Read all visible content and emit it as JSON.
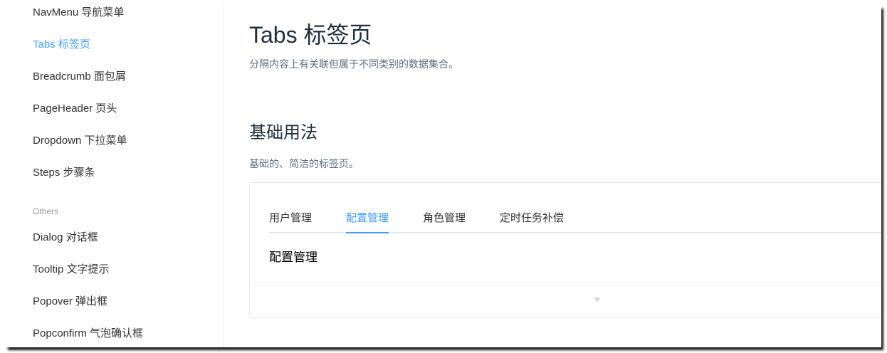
{
  "sidebar": {
    "items": [
      {
        "label": "NavMenu 导航菜单"
      },
      {
        "label": "Tabs 标签页",
        "active": true
      },
      {
        "label": "Breadcrumb 面包屑"
      },
      {
        "label": "PageHeader 页头"
      },
      {
        "label": "Dropdown 下拉菜单"
      },
      {
        "label": "Steps 步骤条"
      }
    ],
    "group_title": "Others",
    "group_items": [
      {
        "label": "Dialog 对话框"
      },
      {
        "label": "Tooltip 文字提示"
      },
      {
        "label": "Popover 弹出框"
      },
      {
        "label": "Popconfirm 气泡确认框"
      }
    ]
  },
  "main": {
    "title": "Tabs 标签页",
    "subtitle": "分隔内容上有关联但属于不同类别的数据集合。",
    "section_title": "基础用法",
    "section_desc": "基础的、简洁的标签页。",
    "demo": {
      "tabs": [
        "用户管理",
        "配置管理",
        "角色管理",
        "定时任务补偿"
      ],
      "active_tab": 1,
      "pane_content": "配置管理"
    }
  },
  "colors": {
    "accent": "#409eff",
    "text": "#303133"
  }
}
